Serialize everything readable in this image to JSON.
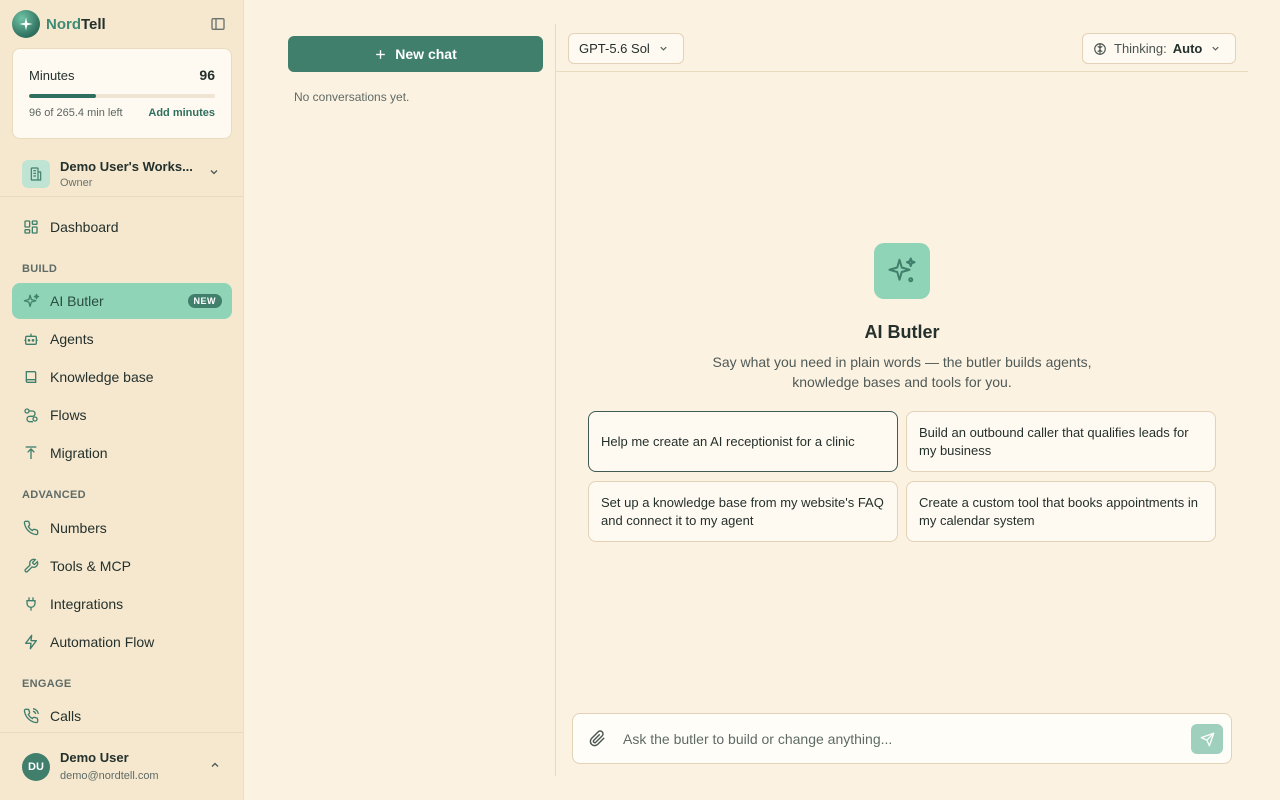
{
  "brand": {
    "name_part1": "Nord",
    "name_part2": "Tell"
  },
  "minutes": {
    "title": "Minutes",
    "value": "96",
    "left_text": "96 of 265.4 min left",
    "add_label": "Add minutes",
    "progress": 0.362
  },
  "workspace": {
    "name": "Demo User's Works...",
    "role": "Owner"
  },
  "nav": {
    "dashboard": "Dashboard",
    "section_build": "BUILD",
    "ai_butler": "AI Butler",
    "ai_butler_badge": "NEW",
    "agents": "Agents",
    "knowledge_base": "Knowledge base",
    "flows": "Flows",
    "migration": "Migration",
    "section_advanced": "ADVANCED",
    "numbers": "Numbers",
    "tools_mcp": "Tools & MCP",
    "integrations": "Integrations",
    "automation_flow": "Automation Flow",
    "section_engage": "ENGAGE",
    "calls": "Calls"
  },
  "user": {
    "initials": "DU",
    "name": "Demo User",
    "email": "demo@nordtell.com"
  },
  "conversations": {
    "new_chat_label": "New chat",
    "empty_text": "No conversations yet."
  },
  "main": {
    "model_label": "GPT-5.6 Sol",
    "thinking_label": "Thinking:",
    "thinking_value": "Auto",
    "hero_title": "AI Butler",
    "hero_subtitle": "Say what you need in plain words — the butler builds agents, knowledge bases and tools for you.",
    "suggestions": [
      "Help me create an AI receptionist for a clinic",
      "Build an outbound caller that qualifies leads for my business",
      "Set up a knowledge base from my website's FAQ and connect it to my agent",
      "Create a custom tool that books appointments in my calendar system"
    ],
    "composer_placeholder": "Ask the butler to build or change anything..."
  },
  "colors": {
    "accent": "#3f7f6c",
    "active_nav": "#8fd4b6",
    "background": "#fcf2e2",
    "sidebar": "#f5e8cf"
  }
}
